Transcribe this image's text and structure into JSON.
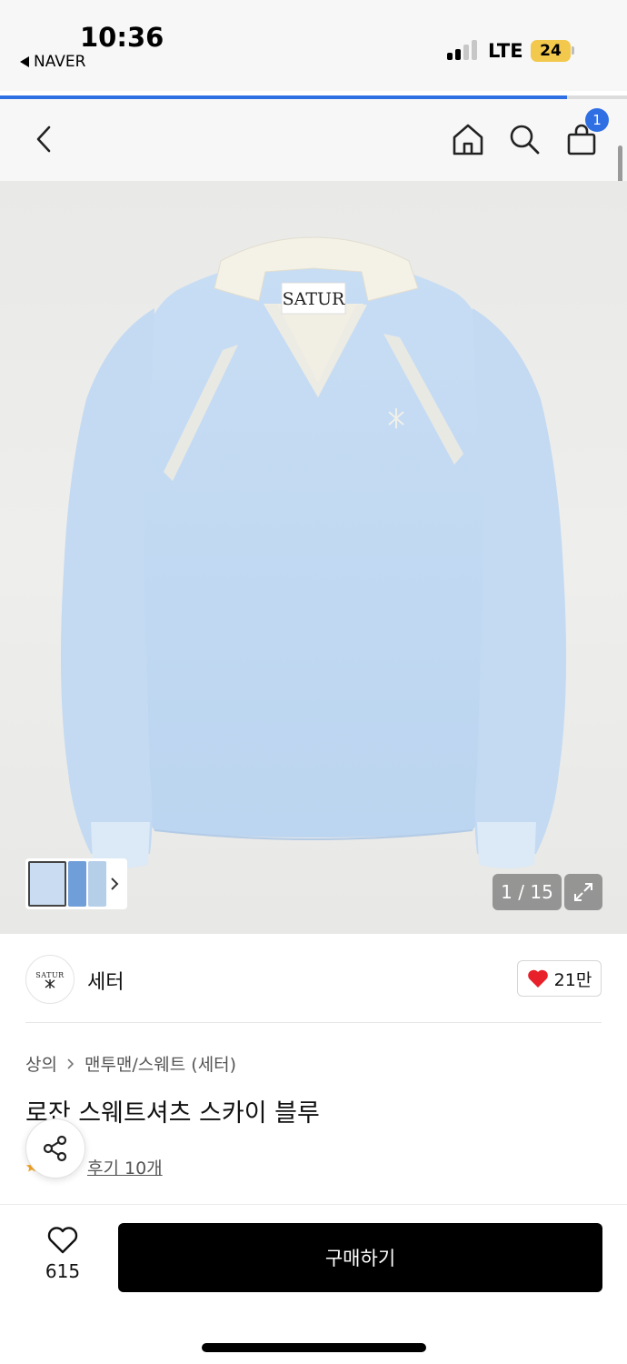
{
  "status_bar": {
    "time": "10:36",
    "back_app": "NAVER",
    "network": "LTE",
    "battery": "24"
  },
  "browser": {
    "load_progress": 0.905
  },
  "nav": {
    "back_icon": "chevron-left-icon",
    "home_icon": "home-icon",
    "search_icon": "search-icon",
    "cart_icon": "shopping-bag-icon",
    "cart_count": "1"
  },
  "gallery": {
    "label_on_product": "SATUR",
    "counter": "1 / 15",
    "expand_icon": "expand-icon",
    "thumbs_arrow": "chevron-right-icon"
  },
  "brand": {
    "logo_text": "SATUR",
    "name": "세터",
    "likes": "21만"
  },
  "product": {
    "breadcrumb": [
      "상의",
      "맨투맨/스웨트 (세터)"
    ],
    "title": "로잔 스웨트셔츠 스카이 블루",
    "review_link": "후기 10개"
  },
  "bottom_bar": {
    "wish_count": "615",
    "buy_label": "구매하기"
  },
  "colors": {
    "accent": "#2f6fe4",
    "heart": "#e8202a",
    "sweater": "#c4dbf3",
    "collar": "#f4f1e6"
  }
}
